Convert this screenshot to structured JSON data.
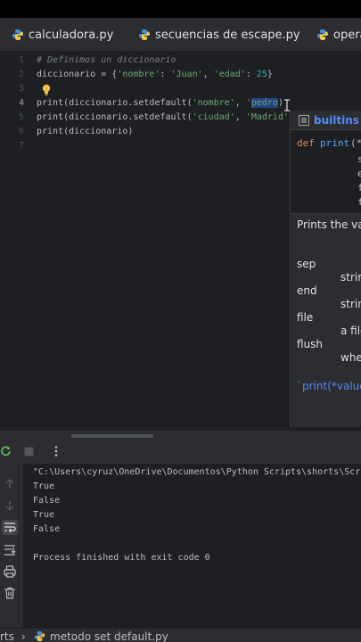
{
  "tabs": [
    {
      "label": "calculadora.py"
    },
    {
      "label": "secuencias de escape.py"
    },
    {
      "label": "opera"
    }
  ],
  "editor": {
    "line_numbers": [
      "1",
      "2",
      "3",
      "4",
      "5",
      "6",
      "7"
    ],
    "line1": "# Definimos un diccionario",
    "line2": {
      "a": "diccionario = {",
      "k1": "'nombre'",
      "c1": ": ",
      "v1": "'Juan'",
      "c2": ", ",
      "k2": "'edad'",
      "c3": ": ",
      "v2": "25",
      "e": "}"
    },
    "line4": {
      "a": "print(diccionario.setdefault(",
      "s1": "'nombre'",
      "b": ", ",
      "q": "'",
      "sel": "pedro",
      "e": ")"
    },
    "line5": {
      "a": "print(diccionario.setdefault(",
      "s1": "'ciudad'",
      "b": ", ",
      "s2": "'Madrid'"
    },
    "line6": "print(diccionario)"
  },
  "popup": {
    "module": "builtins",
    "sig_kw": "def",
    "sig_fn": "print",
    "sig_rest": "(*",
    "sig_lines": [
      "s",
      "e",
      "f",
      "f"
    ],
    "desc": "Prints the va",
    "params": [
      {
        "name": "sep",
        "desc": "strin"
      },
      {
        "name": "end",
        "desc": "strin"
      },
      {
        "name": "file",
        "desc": "a file"
      },
      {
        "name": "flush",
        "desc": "whe"
      }
    ],
    "footer": "`print(*value"
  },
  "console": {
    "lines": [
      "\"C:\\Users\\cyruz\\OneDrive\\Documentos\\Python Scripts\\shorts\\Scrip",
      "True",
      "False",
      "True",
      "False",
      "",
      "Process finished with exit code 0"
    ]
  },
  "statusbar": {
    "left": "rts",
    "sep": "›",
    "file": "metodo set default.py"
  }
}
